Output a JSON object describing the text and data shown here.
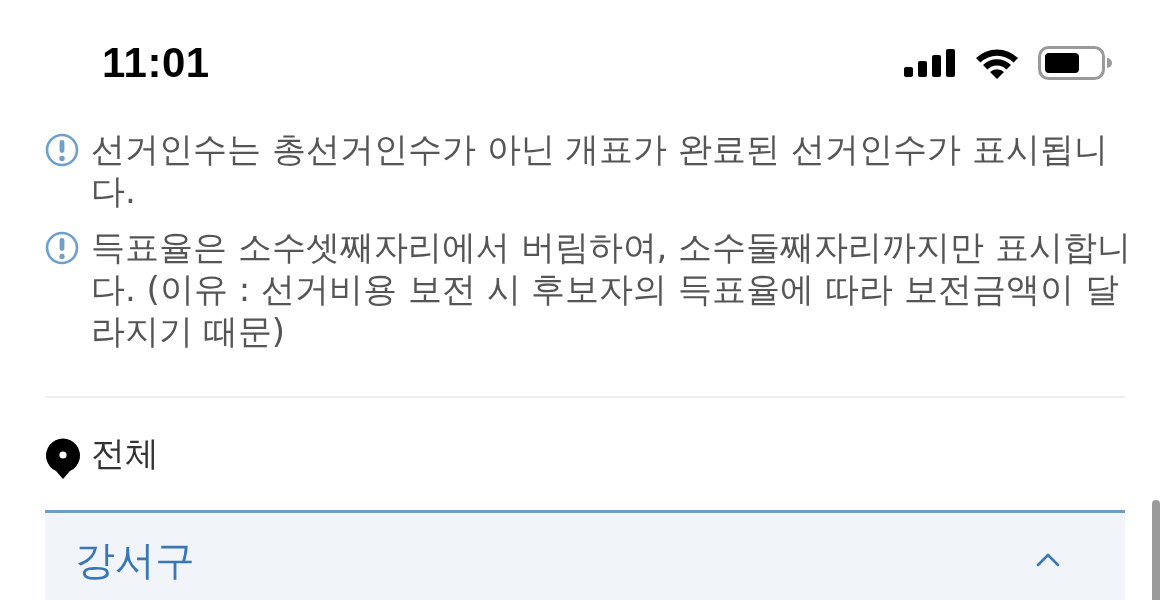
{
  "status_bar": {
    "time": "11:01"
  },
  "notices": [
    {
      "text": "선거인수는 총선거인수가 아닌 개표가 완료된 선거인수가 표시됩니다."
    },
    {
      "text": "득표율은 소수셋째자리에서 버림하여, 소수둘째자리까지만 표시합니다. (이유 : 선거비용 보전 시 후보자의 득표율에 따라 보전금액이 달라지기 때문)"
    }
  ],
  "region_heading": "전체",
  "district_panel": {
    "name": "강서구",
    "expanded": true
  }
}
